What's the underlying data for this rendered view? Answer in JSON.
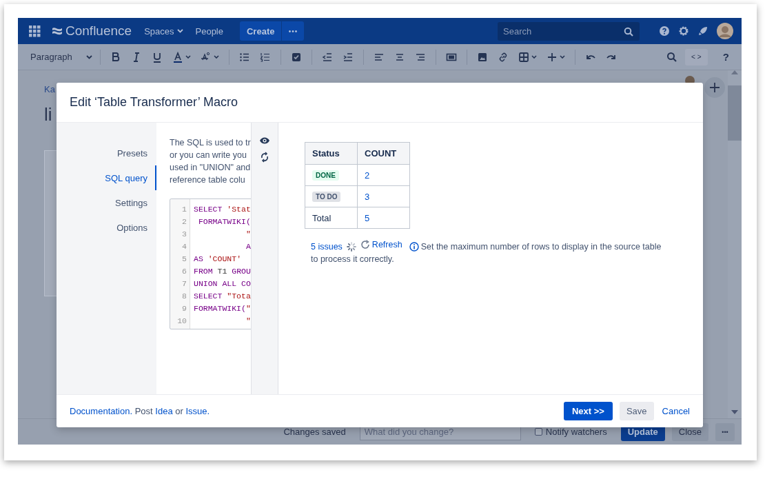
{
  "topnav": {
    "product": "Confluence",
    "links": [
      {
        "label": "Spaces",
        "dropdown": true
      },
      {
        "label": "People",
        "dropdown": false
      }
    ],
    "create": "Create",
    "more": "•••",
    "search": {
      "placeholder": "Search"
    }
  },
  "toolbar": {
    "style": "Paragraph",
    "source_button": "< >",
    "help": "?"
  },
  "page": {
    "breadcrumb": "Ka",
    "title": "li"
  },
  "dialog": {
    "title": "Edit ‘Table Transformer’ Macro",
    "nav": [
      {
        "label": "Presets",
        "selected": false
      },
      {
        "label": "SQL query",
        "selected": true
      },
      {
        "label": "Settings",
        "selected": false
      },
      {
        "label": "Options",
        "selected": false
      }
    ],
    "description": [
      "The SQL is used to tr",
      "or you can write you",
      "used in \"UNION\" and",
      "reference table colu"
    ],
    "code": [
      {
        "number": "1",
        "tokens": [
          {
            "text": "SELECT ",
            "kind": "keyword"
          },
          {
            "text": "'Stat",
            "kind": "string"
          }
        ]
      },
      {
        "number": "2",
        "tokens": [
          {
            "text": " FORMATWIKI(",
            "kind": "keyword"
          }
        ]
      },
      {
        "number": "3",
        "tokens": [
          {
            "text": "           \"",
            "kind": "string"
          }
        ]
      },
      {
        "number": "4",
        "tokens": [
          {
            "text": "           A",
            "kind": "keyword"
          }
        ]
      },
      {
        "number": "5",
        "tokens": [
          {
            "text": "AS ",
            "kind": "keyword"
          },
          {
            "text": "'COUNT'",
            "kind": "string"
          }
        ]
      },
      {
        "number": "6",
        "tokens": [
          {
            "text": "FROM ",
            "kind": "keyword"
          },
          {
            "text": "T1 ",
            "kind": "plain"
          },
          {
            "text": "GROU",
            "kind": "keyword"
          }
        ]
      },
      {
        "number": "7",
        "tokens": [
          {
            "text": "UNION ALL CO",
            "kind": "keyword"
          }
        ]
      },
      {
        "number": "8",
        "tokens": [
          {
            "text": "SELECT ",
            "kind": "keyword"
          },
          {
            "text": "\"Tota",
            "kind": "string"
          }
        ]
      },
      {
        "number": "9",
        "tokens": [
          {
            "text": "FORMATWIKI(",
            "kind": "keyword"
          },
          {
            "text": "\"",
            "kind": "string"
          }
        ]
      },
      {
        "number": "10",
        "tokens": [
          {
            "text": "           \"",
            "kind": "string"
          }
        ]
      }
    ],
    "preview": {
      "columns": [
        "Status",
        "COUNT"
      ],
      "rows": [
        {
          "status": {
            "text": "DONE",
            "kind": "lozenge-success"
          },
          "count": "2"
        },
        {
          "status": {
            "text": "TO DO",
            "kind": "lozenge-default"
          },
          "count": "3"
        },
        {
          "status": {
            "text": "Total",
            "kind": "plain"
          },
          "count": "5"
        }
      ],
      "issues_link": "5 issues",
      "refresh": "Refresh",
      "note": "Set the maximum number of rows to display in the source table to process it correctly."
    },
    "footer": {
      "documentation": "Documentation.",
      "post": "Post",
      "idea": "Idea",
      "or": "or",
      "issue": "Issue.",
      "next": "Next >>",
      "save": "Save",
      "cancel": "Cancel"
    }
  },
  "bottombar": {
    "status": "Changes saved",
    "comment": {
      "placeholder": "What did you change?"
    },
    "notify": {
      "label": "Notify watchers",
      "checked": false
    },
    "update": "Update",
    "close": "Close",
    "more": "•••"
  }
}
